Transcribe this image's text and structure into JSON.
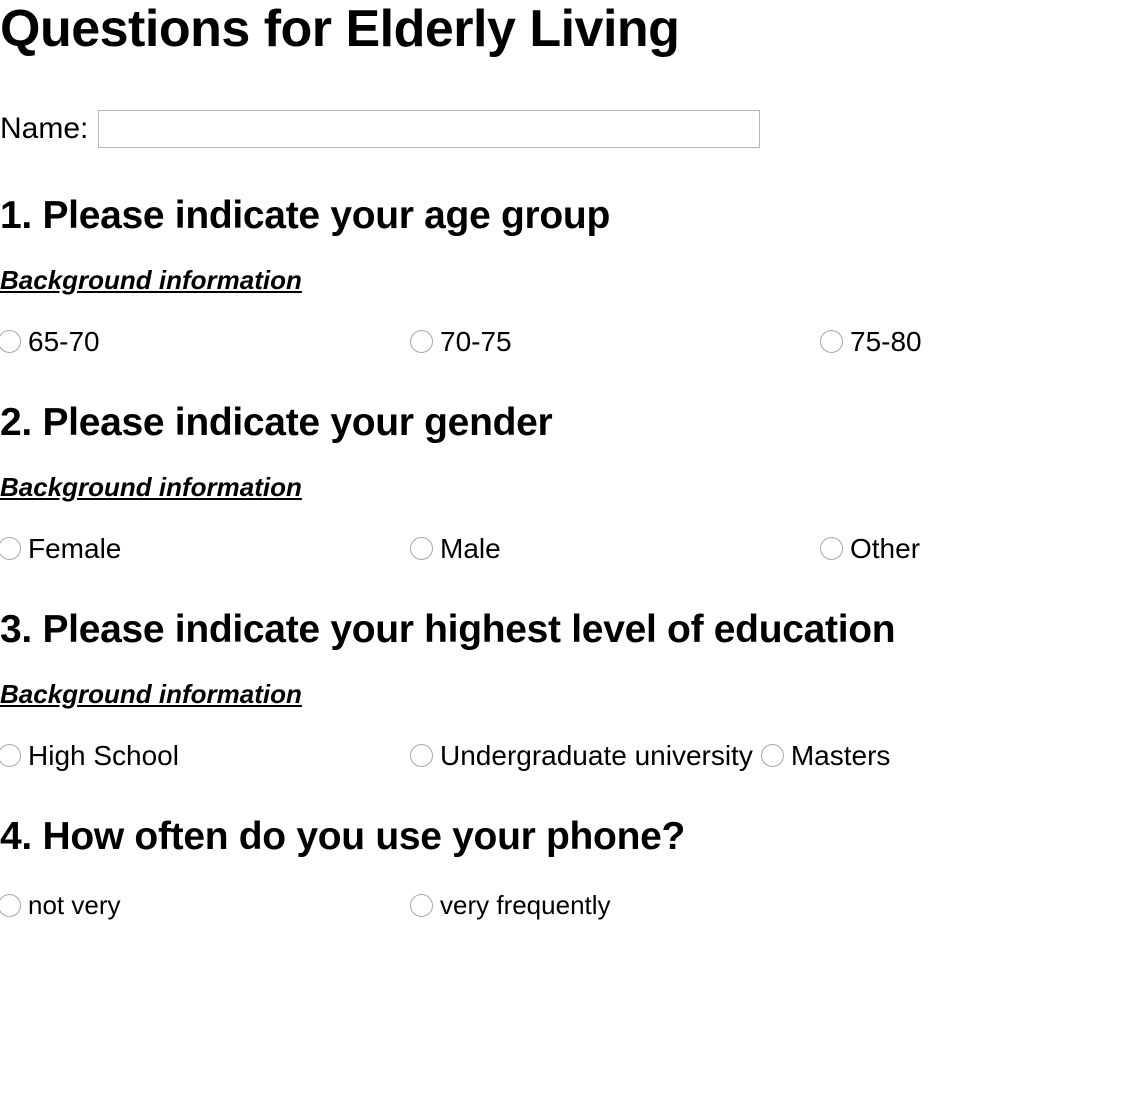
{
  "title": "Questions for Elderly Living",
  "name_field": {
    "label": "Name:",
    "value": "",
    "placeholder": ""
  },
  "subtitle_text": "Background information",
  "questions": [
    {
      "title": "1. Please indicate your age group",
      "subtitle": "Background information",
      "options": [
        {
          "label": "65-70"
        },
        {
          "label": "70-75"
        },
        {
          "label": "75-80"
        }
      ]
    },
    {
      "title": "2. Please indicate your gender",
      "subtitle": "Background information",
      "options": [
        {
          "label": "Female"
        },
        {
          "label": "Male"
        },
        {
          "label": "Other"
        }
      ]
    },
    {
      "title": "3. Please indicate your highest level of education",
      "subtitle": "Background information",
      "options": [
        {
          "label": "High School"
        },
        {
          "label": "Undergraduate university"
        },
        {
          "label": "Masters"
        }
      ]
    },
    {
      "title": "4. How often do you use your phone?",
      "subtitle": "",
      "options": [
        {
          "label": "not very"
        },
        {
          "label": "very frequently"
        }
      ]
    }
  ],
  "colors": {
    "background": "#ffffff",
    "text": "#000000",
    "input_border": "#b5b5b5",
    "radio_border": "#a8a8a8"
  }
}
